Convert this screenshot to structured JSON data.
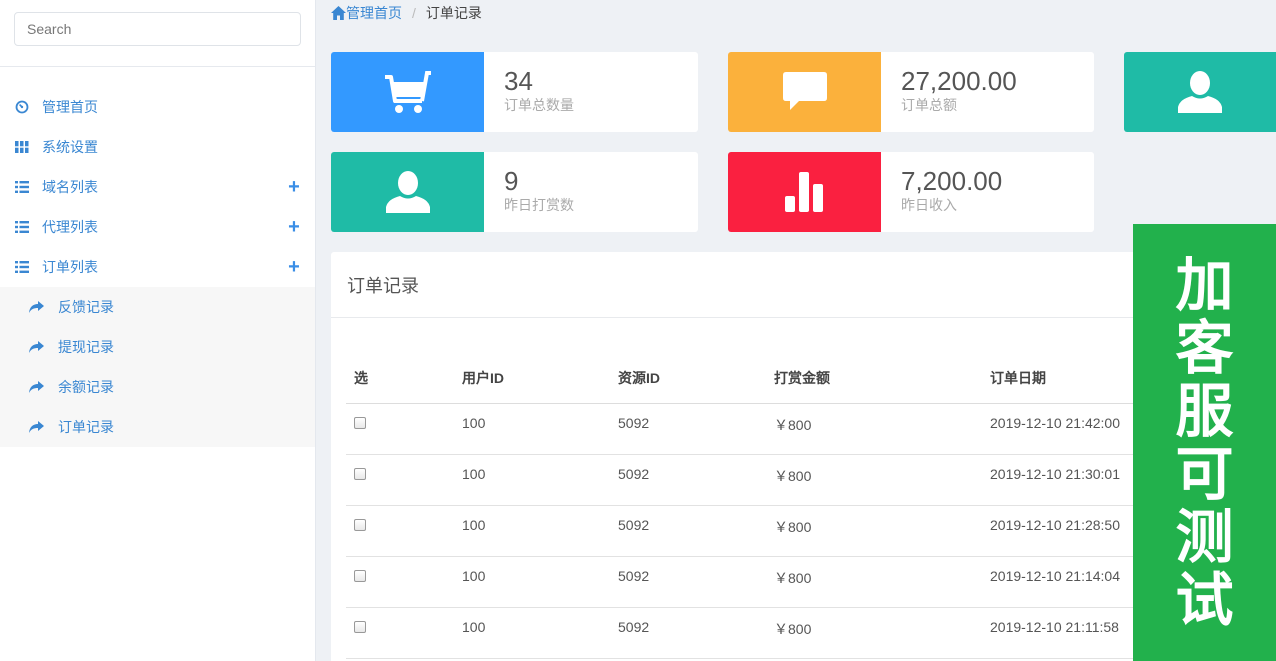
{
  "search": {
    "placeholder": "Search"
  },
  "sidebar": {
    "items": [
      {
        "label": "管理首页",
        "icon": "dashboard-icon",
        "expandable": false
      },
      {
        "label": "系统设置",
        "icon": "grid-icon",
        "expandable": false
      },
      {
        "label": "域名列表",
        "icon": "list-icon",
        "expandable": true
      },
      {
        "label": "代理列表",
        "icon": "list-icon",
        "expandable": true
      },
      {
        "label": "订单列表",
        "icon": "list-icon",
        "expandable": true
      }
    ],
    "subitems": [
      {
        "label": "反馈记录",
        "icon": "share-arrow-icon"
      },
      {
        "label": "提现记录",
        "icon": "share-arrow-icon"
      },
      {
        "label": "余额记录",
        "icon": "share-arrow-icon"
      },
      {
        "label": "订单记录",
        "icon": "share-arrow-icon"
      }
    ]
  },
  "breadcrumb": {
    "home": "管理首页",
    "separator": "/",
    "current": "订单记录"
  },
  "stats": [
    {
      "value": "34",
      "label": "订单总数量",
      "color": "#3399ff",
      "icon": "cart-icon"
    },
    {
      "value": "27,200.00",
      "label": "订单总额",
      "color": "#fbb13c",
      "icon": "comment-icon"
    },
    {
      "value": "",
      "label": "",
      "color": "#1fbba6",
      "icon": "user-icon"
    },
    {
      "value": "9",
      "label": "昨日打赏数",
      "color": "#1fbba6",
      "icon": "user-icon"
    },
    {
      "value": "7,200.00",
      "label": "昨日收入",
      "color": "#fa2040",
      "icon": "bar-chart-icon"
    }
  ],
  "orders": {
    "title": "订单记录",
    "columns": [
      "选",
      "用户ID",
      "资源ID",
      "打赏金额",
      "订单日期"
    ],
    "rows": [
      {
        "user_id": "100",
        "resource_id": "5092",
        "amount": "￥800",
        "date": "2019-12-10 21:42:00"
      },
      {
        "user_id": "100",
        "resource_id": "5092",
        "amount": "￥800",
        "date": "2019-12-10 21:30:01"
      },
      {
        "user_id": "100",
        "resource_id": "5092",
        "amount": "￥800",
        "date": "2019-12-10 21:28:50"
      },
      {
        "user_id": "100",
        "resource_id": "5092",
        "amount": "￥800",
        "date": "2019-12-10 21:14:04"
      },
      {
        "user_id": "100",
        "resource_id": "5092",
        "amount": "￥800",
        "date": "2019-12-10 21:11:58"
      }
    ]
  },
  "promo": {
    "chars": [
      "加",
      "客",
      "服",
      "可",
      "测",
      "试"
    ],
    "color": "#22b14c"
  }
}
